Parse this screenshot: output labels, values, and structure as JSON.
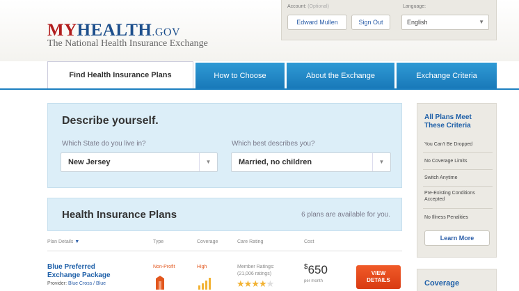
{
  "header": {
    "logo_my": "MY",
    "logo_health": "HEALTH",
    "logo_gov": ".GOV",
    "tagline": "The National Health Insurance Exchange"
  },
  "account": {
    "label": "Account:",
    "optional": "(Optional)",
    "user_button": "Edward Mullen",
    "signout_button": "Sign Out",
    "language_label": "Language:",
    "language_value": "English"
  },
  "tabs": [
    {
      "label": "Find Health Insurance Plans"
    },
    {
      "label": "How to Choose"
    },
    {
      "label": "About the Exchange"
    },
    {
      "label": "Exchange Criteria"
    }
  ],
  "describe": {
    "title": "Describe yourself.",
    "state_question": "Which State do you live in?",
    "state_value": "New Jersey",
    "status_question": "Which best describes you?",
    "status_value": "Married, no children"
  },
  "plans": {
    "title": "Health Insurance Plans",
    "count_text": "6 plans are available for you.",
    "columns": {
      "details": "Plan Details",
      "type": "Type",
      "coverage": "Coverage",
      "rating": "Care Rating",
      "cost": "Cost"
    },
    "rows": [
      {
        "name_line1": "Blue Preferred",
        "name_line2": "Exchange Package",
        "provider_label": "Provider:",
        "provider": "Blue Cross / Blue",
        "type": "Non-Profit",
        "coverage": "High",
        "rating_label": "Member Ratings:",
        "rating_count": "(21,006 ratings)",
        "rating_stars": 3.5,
        "price_symbol": "$",
        "price": "650",
        "per": "per month",
        "view_line1": "VIEW",
        "view_line2": "DETAILS"
      }
    ]
  },
  "sidebar": {
    "title_line1": "All Plans Meet",
    "title_line2": "These Criteria",
    "criteria": [
      "You Can't Be Dropped",
      "No Coverage Limits",
      "Switch Anytime",
      "Pre-Existing Conditions Accepted",
      "No Illness Penalities"
    ],
    "learn_more": "Learn More",
    "coverage_title": "Coverage"
  },
  "colors": {
    "tab_blue": "#1f86c6",
    "panel_blue": "#dceef8",
    "brand_red": "#b21d1d",
    "brand_blue": "#1d4f8c",
    "cta_orange": "#e8481c"
  }
}
